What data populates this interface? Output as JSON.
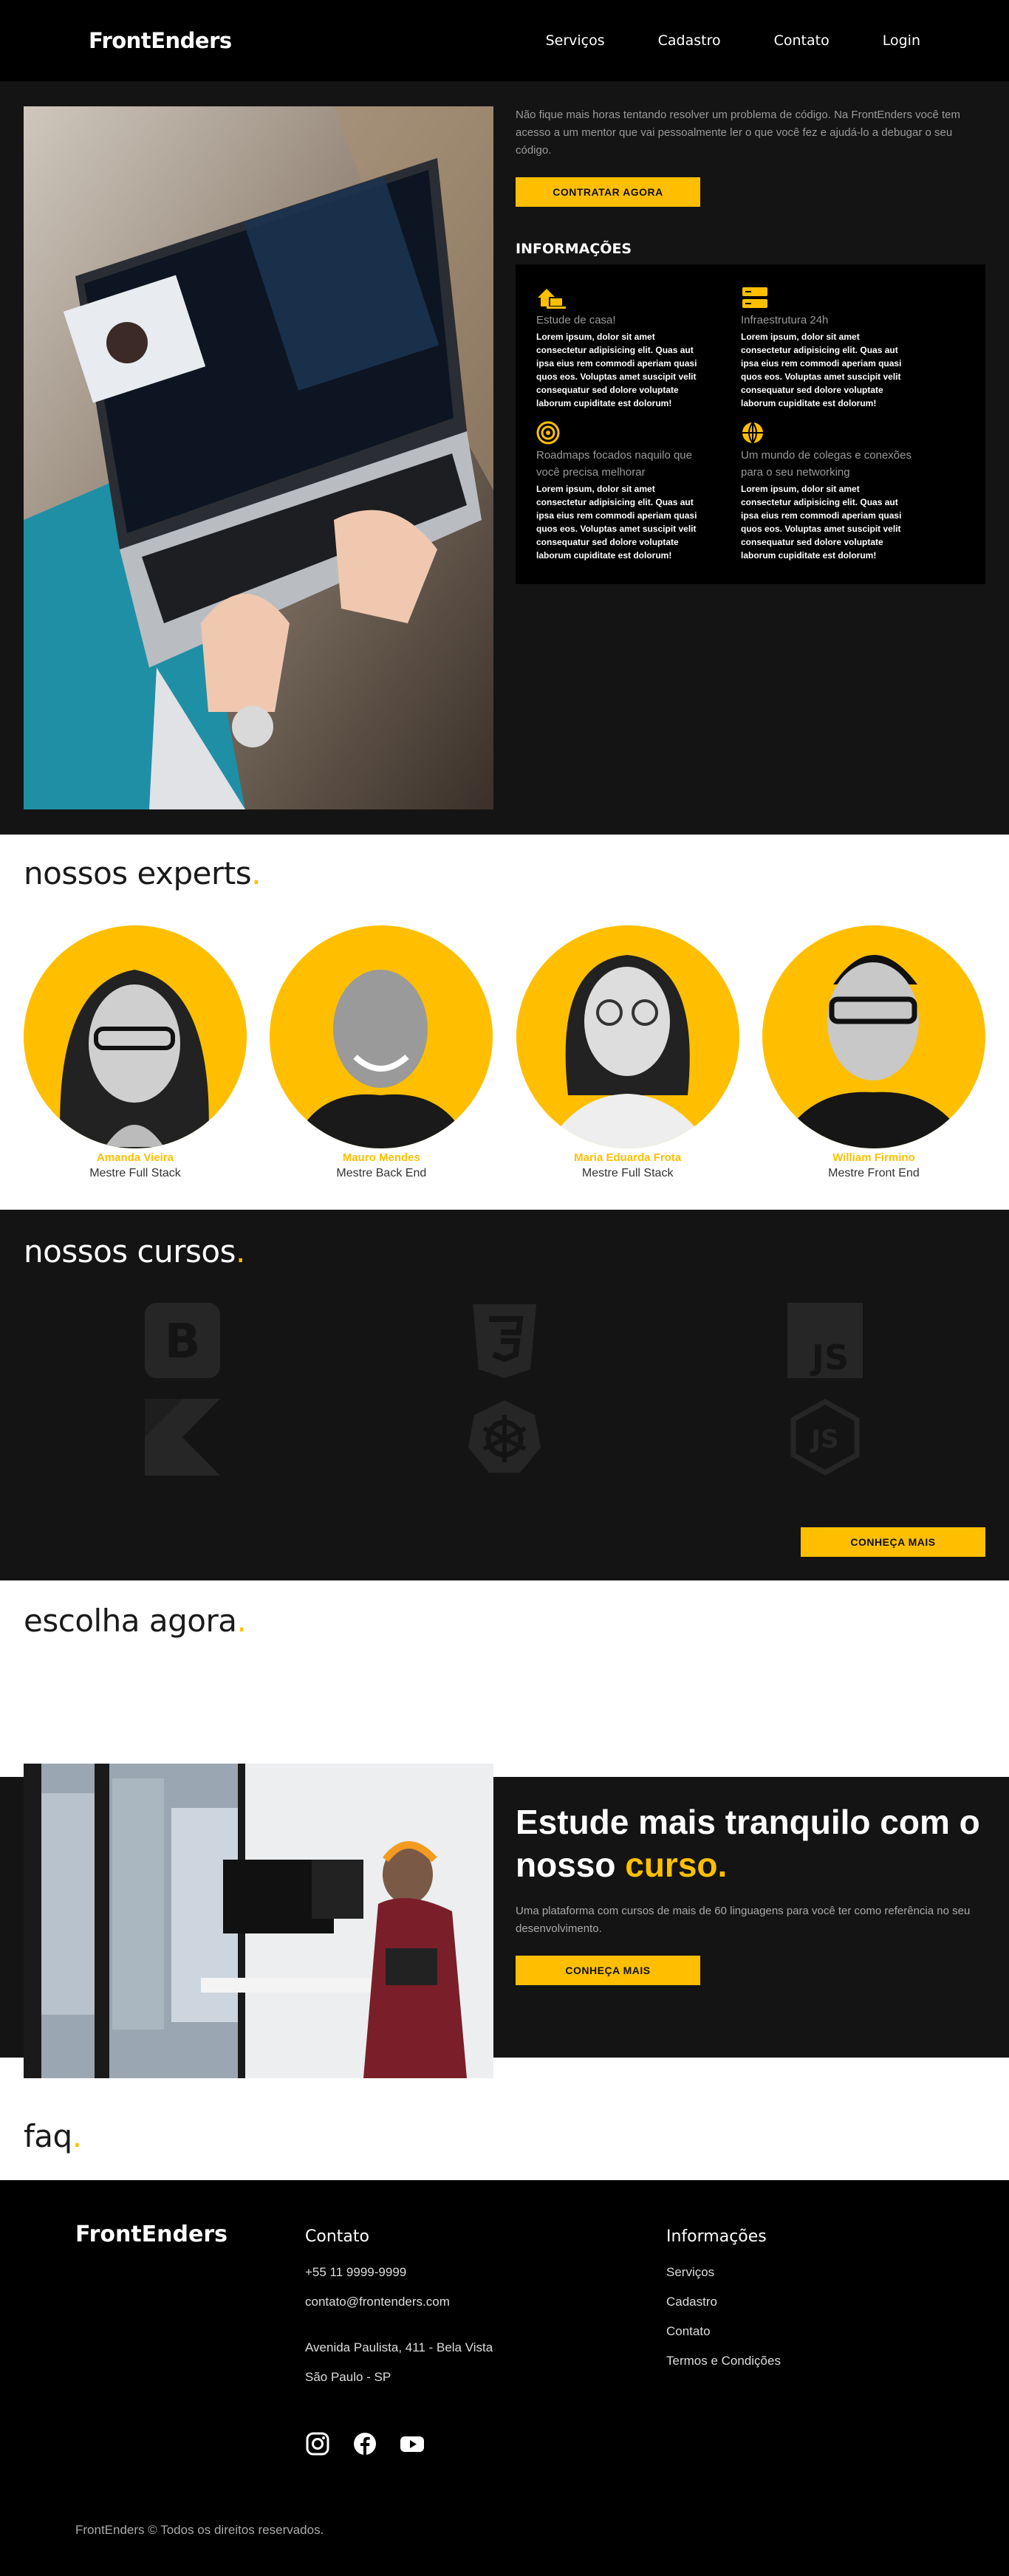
{
  "nav": {
    "brand": "FrontEnders",
    "links": [
      "Serviços",
      "Cadastro",
      "Contato",
      "Login"
    ]
  },
  "hero": {
    "text": "Não fique mais horas tentando resolver um problema de código. Na FrontEnders você tem acesso a um mentor que vai pessoalmente ler o que você fez e ajudá-lo a debugar o seu código.",
    "button": "CONTRATAR AGORA",
    "info_title": "INFORMAÇÕES",
    "info_items": [
      {
        "icon": "home-laptop-icon",
        "title": "Estude de casa!",
        "desc": "Lorem ipsum, dolor sit amet consectetur adipisicing elit. Quas aut ipsa eius rem commodi aperiam quasi quos eos. Voluptas amet suscipit velit consequatur sed dolore voluptate laborum cupiditate est dolorum!"
      },
      {
        "icon": "server-icon",
        "title": "Infraestrutura 24h",
        "desc": "Lorem ipsum, dolor sit amet consectetur adipisicing elit. Quas aut ipsa eius rem commodi aperiam quasi quos eos. Voluptas amet suscipit velit consequatur sed dolore voluptate laborum cupiditate est dolorum!"
      },
      {
        "icon": "target-icon",
        "title": "Roadmaps focados naquilo que você precisa melhorar",
        "desc": "Lorem ipsum, dolor sit amet consectetur adipisicing elit. Quas aut ipsa eius rem commodi aperiam quasi quos eos. Voluptas amet suscipit velit consequatur sed dolore voluptate laborum cupiditate est dolorum!"
      },
      {
        "icon": "globe-icon",
        "title": "Um mundo de colegas e conexões para o seu networking",
        "desc": "Lorem ipsum, dolor sit amet consectetur adipisicing elit. Quas aut ipsa eius rem commodi aperiam quasi quos eos. Voluptas amet suscipit velit consequatur sed dolore voluptate laborum cupiditate est dolorum!"
      }
    ]
  },
  "experts": {
    "title": "nossos experts",
    "dot": ".",
    "people": [
      {
        "name": "Amanda Vieira",
        "role": "Mestre Full Stack"
      },
      {
        "name": "Mauro Mendes",
        "role": "Mestre Back End"
      },
      {
        "name": "Maria Eduarda Frota",
        "role": "Mestre Full Stack"
      },
      {
        "name": "William Firmino",
        "role": "Mestre Front End"
      }
    ]
  },
  "courses": {
    "title": "nossos cursos",
    "dot": ".",
    "logos": [
      "bootstrap-icon",
      "css3-icon",
      "javascript-icon",
      "kotlin-icon",
      "kubernetes-icon",
      "nodejs-icon"
    ],
    "button": "CONHEÇA MAIS"
  },
  "escolha": {
    "title": "escolha agora",
    "dot": "."
  },
  "study": {
    "title_part1": "Estude mais tranquilo com o nosso ",
    "title_highlight": "curso.",
    "text": "Uma plataforma com cursos de mais de 60 linguagens para você ter como referência no seu desenvolvimento.",
    "button": "CONHEÇA MAIS"
  },
  "faq": {
    "title": "faq",
    "dot": "."
  },
  "footer": {
    "brand": "FrontEnders",
    "contact_title": "Contato",
    "phone": "+55 11 9999-9999",
    "email": "contato@frontenders.com",
    "address1": "Avenida Paulista, 411 - Bela Vista",
    "address2": "São Paulo - SP",
    "info_title": "Informações",
    "info_links": [
      "Serviços",
      "Cadastro",
      "Contato",
      "Termos e Condições"
    ],
    "socials": [
      "instagram-icon",
      "facebook-icon",
      "youtube-icon"
    ],
    "copyright": "FrontEnders © Todos os direitos reservados."
  },
  "colors": {
    "accent": "#ffbf00",
    "dark": "#141414",
    "black": "#000000"
  }
}
